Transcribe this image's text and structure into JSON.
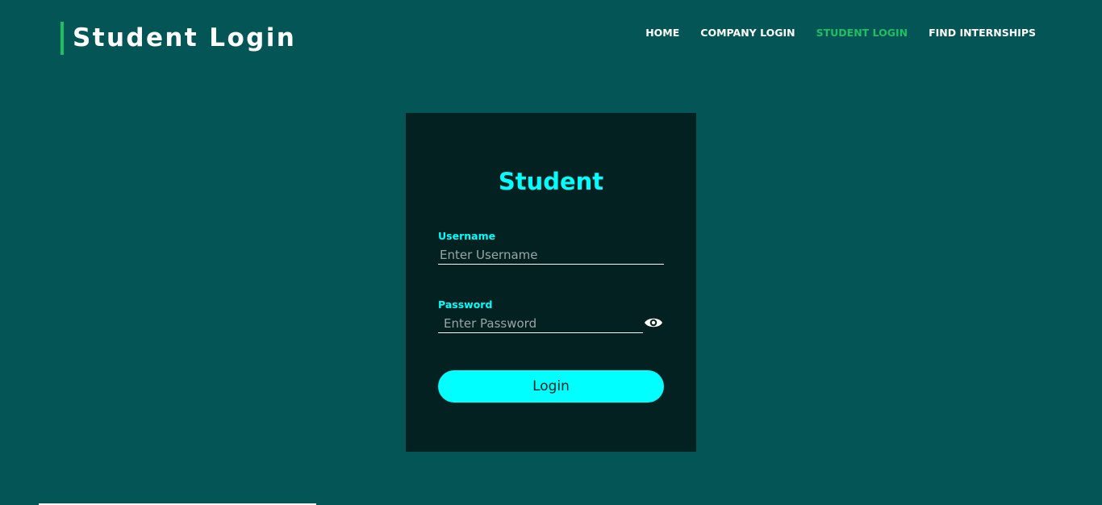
{
  "header": {
    "title": "Student Login"
  },
  "nav": {
    "items": [
      {
        "label": "HOME",
        "active": false
      },
      {
        "label": "COMPANY LOGIN",
        "active": false
      },
      {
        "label": "STUDENT LOGIN",
        "active": true
      },
      {
        "label": "FIND INTERNSHIPS",
        "active": false
      }
    ]
  },
  "login_card": {
    "title": "Student",
    "username": {
      "label": "Username",
      "placeholder": "Enter Username",
      "value": ""
    },
    "password": {
      "label": "Password",
      "placeholder": "Enter Password",
      "value": ""
    },
    "show_password_icon": "eye-icon",
    "submit_label": "Login"
  },
  "colors": {
    "background": "#045555",
    "card_background": "#032121",
    "accent_cyan": "#00ffff",
    "accent_green": "#1fbf63",
    "text_white": "#ffffff"
  }
}
